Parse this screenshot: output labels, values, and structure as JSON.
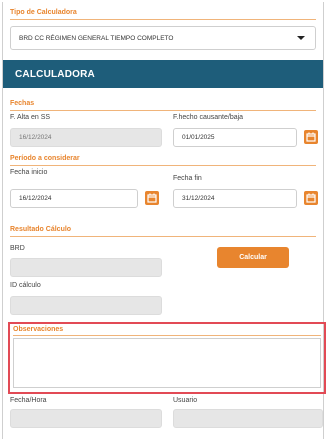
{
  "calculator_type": {
    "label": "Tipo de Calculadora",
    "selected": "BRD CC RÉGIMEN GENERAL TIEMPO COMPLETO"
  },
  "banner": {
    "title": "CALCULADORA"
  },
  "fechas": {
    "section": "Fechas",
    "alta_label": "F. Alta en SS",
    "alta_value": "16/12/2024",
    "hecho_label": "F.hecho causante/baja",
    "hecho_value": "01/01/2025"
  },
  "periodo": {
    "section": "Período a considerar",
    "inicio_label": "Fecha inicio",
    "inicio_value": "16/12/2024",
    "fin_label": "Fecha fin",
    "fin_value": "31/12/2024"
  },
  "resultado": {
    "section": "Resultado Cálculo",
    "brd_label": "BRD",
    "brd_value": "",
    "calc_button": "Calcular",
    "id_label": "ID cálculo",
    "id_value": ""
  },
  "observaciones": {
    "label": "Observaciones",
    "value": ""
  },
  "footer": {
    "fecha_hora_label": "Fecha/Hora",
    "fecha_hora_value": "",
    "usuario_label": "Usuario",
    "usuario_value": ""
  },
  "colors": {
    "accent": "#e8852e",
    "header": "#1e5d7a",
    "highlight": "#e24a55",
    "disabled_field": "#e6e6e6"
  },
  "icons": {
    "calendar": "calendar-icon",
    "dropdown": "chevron-down-icon"
  }
}
